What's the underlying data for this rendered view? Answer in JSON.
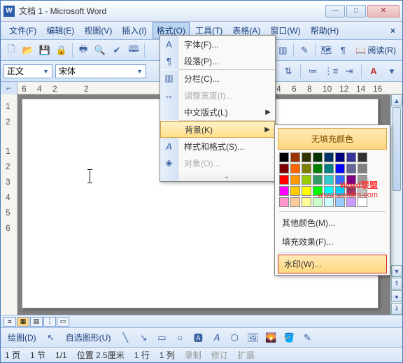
{
  "titlebar": {
    "title": "文档 1 - Microsoft Word"
  },
  "menubar": {
    "file": "文件(F)",
    "edit": "编辑(E)",
    "view": "视图(V)",
    "insert": "插入(I)",
    "format": "格式(O)",
    "tools": "工具(T)",
    "table": "表格(A)",
    "window": "窗口(W)",
    "help": "帮助(H)"
  },
  "toolbar": {
    "read": "阅读(R)"
  },
  "formatbar": {
    "style": "正文",
    "font": "宋体"
  },
  "ruler": {
    "n0": "6",
    "n1": "4",
    "n2": "2",
    "n3": "2",
    "n4": "4",
    "n5": "6",
    "n6": "8",
    "n7": "10",
    "n8": "12",
    "n9": "14",
    "n10": "16"
  },
  "vruler": {
    "v1": "1",
    "v2": "2",
    "v3": "1",
    "v4": "2",
    "v5": "3",
    "v6": "4",
    "v7": "5",
    "v8": "6"
  },
  "dropdown": {
    "font": "字体(F)...",
    "paragraph": "段落(P)...",
    "borders": "分栏(C)...",
    "width": "调整宽度(I)...",
    "asian": "中文版式(L)",
    "background": "背景(K)",
    "styles": "样式和格式(S)...",
    "object": "对象(O)..."
  },
  "submenu": {
    "nofill": "无填充颜色",
    "more": "其他颜色(M)...",
    "effects": "填充效果(F)...",
    "watermark": "水印(W)..."
  },
  "palette": {
    "colors": [
      "#000000",
      "#993300",
      "#333300",
      "#003300",
      "#003366",
      "#000080",
      "#333399",
      "#333333",
      "#800000",
      "#ff6600",
      "#808000",
      "#008000",
      "#008080",
      "#0000ff",
      "#666699",
      "#808080",
      "#ff0000",
      "#ff9900",
      "#99cc00",
      "#339966",
      "#33cccc",
      "#3366ff",
      "#800080",
      "#999999",
      "#ff00ff",
      "#ffcc00",
      "#ffff00",
      "#00ff00",
      "#00ffff",
      "#00ccff",
      "#993366",
      "#c0c0c0",
      "#ff99cc",
      "#ffcc99",
      "#ffff99",
      "#ccffcc",
      "#ccffff",
      "#99ccff",
      "#cc99ff",
      "#ffffff"
    ]
  },
  "watermark": {
    "line1": "Word联盟",
    "line2": "www.wordlm.com"
  },
  "drawbar": {
    "draw": "绘图(D)",
    "autoshapes": "自选图形(U)"
  },
  "statusbar": {
    "page": "1 页",
    "sec": "1 节",
    "pages": "1/1",
    "pos": "位置 2.5厘米",
    "line": "1 行",
    "col": "1 列",
    "rec": "录制",
    "rev": "修订",
    "ext": "扩展"
  }
}
